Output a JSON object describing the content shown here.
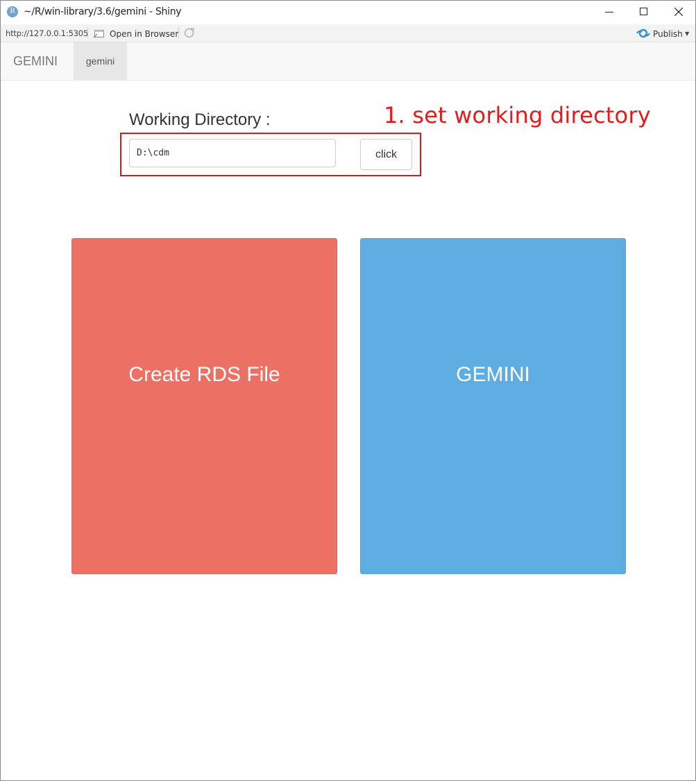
{
  "window": {
    "app_icon_letter": "R",
    "title": "~/R/win-library/3.6/gemini - Shiny"
  },
  "toolbar": {
    "url": "http://127.0.0.1:5305",
    "open_in_browser": "Open in Browser",
    "publish": "Publish"
  },
  "navbar": {
    "brand": "GEMINI",
    "tabs": [
      {
        "label": "gemini",
        "active": true
      }
    ]
  },
  "main": {
    "working_directory_label": "Working Directory :",
    "working_directory_value": "D:\\cdm",
    "click_button": "click",
    "annotation": "1. set working directory",
    "tiles": [
      {
        "label": "Create RDS File",
        "color": "#ec7063"
      },
      {
        "label": "GEMINI",
        "color": "#5dade2"
      }
    ]
  },
  "colors": {
    "annotation": "#e81919",
    "navbar_bg": "#f8f8f8",
    "active_tab_bg": "#e7e7e7"
  }
}
